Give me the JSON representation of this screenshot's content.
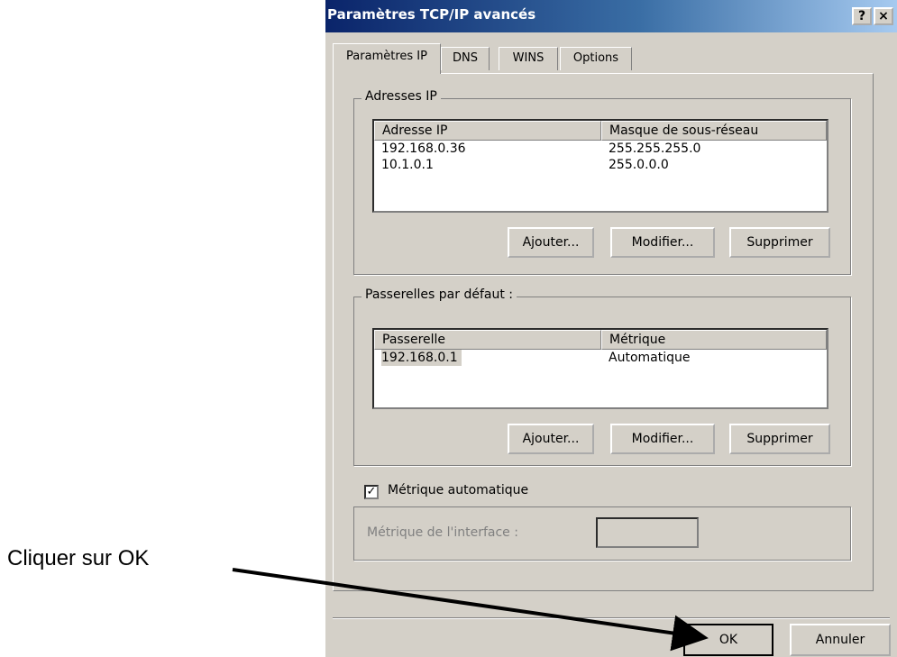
{
  "window": {
    "title": "Paramètres TCP/IP avancés",
    "help_button": "?",
    "close_button": "×"
  },
  "tabs": [
    {
      "label": "Paramètres IP",
      "active": true
    },
    {
      "label": "DNS",
      "active": false
    },
    {
      "label": "WINS",
      "active": false
    },
    {
      "label": "Options",
      "active": false
    }
  ],
  "ip_group": {
    "label": "Adresses IP",
    "columns": [
      "Adresse IP",
      "Masque de sous-réseau"
    ],
    "rows": [
      [
        "192.168.0.36",
        "255.255.255.0"
      ],
      [
        "10.1.0.1",
        "255.0.0.0"
      ]
    ],
    "add_label": "Ajouter...",
    "edit_label": "Modifier...",
    "delete_label": "Supprimer"
  },
  "gateway_group": {
    "label": "Passerelles par défaut :",
    "columns": [
      "Passerelle",
      "Métrique"
    ],
    "rows": [
      [
        "192.168.0.1",
        "Automatique"
      ]
    ],
    "add_label": "Ajouter...",
    "edit_label": "Modifier...",
    "delete_label": "Supprimer"
  },
  "auto_metric": {
    "label": "Métrique automatique",
    "checked": true,
    "check_glyph": "✓"
  },
  "interface_metric": {
    "label": "Métrique de l'interface :",
    "value": ""
  },
  "footer": {
    "ok_label": "OK",
    "cancel_label": "Annuler"
  },
  "annotation": {
    "text": "Cliquer sur OK"
  }
}
